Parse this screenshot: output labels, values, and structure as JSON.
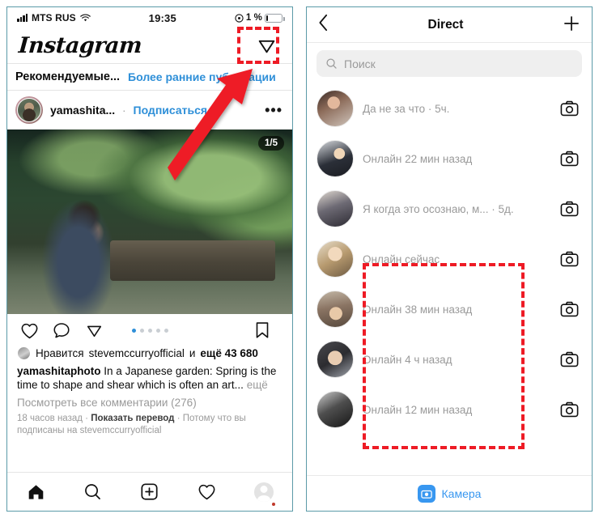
{
  "left_phone": {
    "status_bar": {
      "carrier": "MTS RUS",
      "time": "19:35",
      "battery_percent": "1 %",
      "alarm_icon": "alarm-icon",
      "wifi_icon": "wifi-icon",
      "signal_icon": "signal-bars-icon"
    },
    "header": {
      "logo": "Instagram",
      "direct_icon": "direct-send-icon"
    },
    "recommended_bar": {
      "title": "Рекомендуемые...",
      "link": "Более ранние публикации"
    },
    "post": {
      "username": "yamashita...",
      "separator": "·",
      "follow_label": "Подписаться",
      "more_icon": "more-options-icon",
      "carousel_badge": "1/5",
      "carousel_dots": 5,
      "carousel_active": 1,
      "actions": {
        "like_icon": "heart-icon",
        "comment_icon": "comment-bubble-icon",
        "share_icon": "share-send-icon",
        "save_icon": "bookmark-icon"
      },
      "likes_prefix": "Нравится",
      "likes_user": "stevemccurryofficial",
      "likes_conj": "и",
      "likes_count": "ещё 43 680",
      "caption_user": "yamashitaphoto",
      "caption_text": "In a Japanese garden: Spring is the time to shape and shear which is often an art...",
      "caption_more": "ещё",
      "comments_link": "Посмотреть все комментарии (276)",
      "meta_time": "18 часов назад",
      "meta_translate": "Показать перевод",
      "meta_reason": "Потому что вы подписаны на stevemccurryofficial"
    },
    "tabbar": {
      "home_icon": "home-icon",
      "search_icon": "search-icon",
      "add_icon": "add-post-icon",
      "activity_icon": "heart-icon",
      "profile_icon": "profile-avatar-icon"
    }
  },
  "right_phone": {
    "header": {
      "back_icon": "chevron-left-icon",
      "title": "Direct",
      "new_message_icon": "plus-icon"
    },
    "search": {
      "icon": "search-icon",
      "placeholder": "Поиск"
    },
    "conversations": [
      {
        "avatar": "a1",
        "subtitle": "Да не за что · 5ч.",
        "camera_icon": "camera-icon",
        "muted": false
      },
      {
        "avatar": "a2",
        "subtitle": "Онлайн 22 мин назад",
        "camera_icon": "camera-icon",
        "muted": false
      },
      {
        "avatar": "a3",
        "subtitle": "Я когда это осознаю, м...   · 5д.",
        "camera_icon": "camera-icon",
        "muted": true
      },
      {
        "avatar": "a4",
        "subtitle": "Онлайн сейчас",
        "camera_icon": "camera-icon",
        "muted": false
      },
      {
        "avatar": "a5",
        "subtitle": "Онлайн 38 мин назад",
        "camera_icon": "camera-icon",
        "muted": false
      },
      {
        "avatar": "a6",
        "subtitle": "Онлайн 4 ч назад",
        "camera_icon": "camera-icon",
        "muted": false
      },
      {
        "avatar": "a7",
        "subtitle": "Онлайн 12 мин назад",
        "camera_icon": "camera-icon",
        "muted": false
      }
    ],
    "camera_bar": {
      "icon": "camera-icon",
      "label": "Камера"
    }
  },
  "annotations": {
    "highlight_color": "#ee1b25",
    "arrow_color": "#ee1b25",
    "highlight_direct_icon": "dashed-highlight-direct-icon",
    "highlight_online_statuses": "dashed-highlight-online-statuses",
    "arrow": "red-arrow-pointing-to-direct-icon"
  },
  "theme": {
    "accent_blue": "#2e8fd8",
    "link_blue": "#3897f0",
    "muted_gray": "#9a9a9a",
    "frame_border": "#5b9aa8"
  }
}
